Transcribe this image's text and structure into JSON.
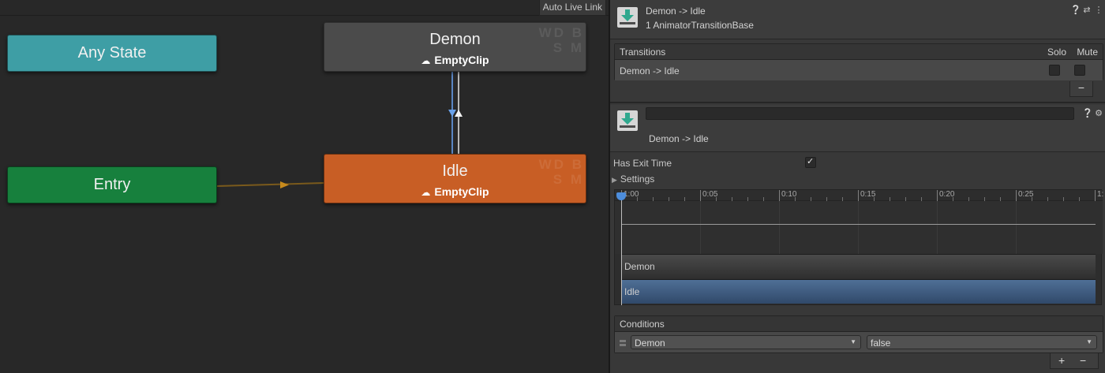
{
  "graph": {
    "auto_live_link": "Auto Live Link",
    "nodes": {
      "any_state": {
        "title": "Any State",
        "color": "#3e9ea5"
      },
      "entry": {
        "title": "Entry",
        "color": "#17803d"
      },
      "demon": {
        "title": "Demon",
        "clip": "EmptyClip",
        "badge_top": "WD B",
        "badge_bottom": "S M",
        "color": "#4b4b4b"
      },
      "idle": {
        "title": "Idle",
        "clip": "EmptyClip",
        "badge_top": "WD B",
        "badge_bottom": "S M",
        "color": "#c85e25"
      }
    }
  },
  "inspector": {
    "header": {
      "title": "Demon -> Idle",
      "subtitle": "1 AnimatorTransitionBase",
      "icons": [
        "help-icon",
        "settings-sliders-icon",
        "more-icon"
      ]
    },
    "transitions": {
      "header": "Transitions",
      "solo_label": "Solo",
      "mute_label": "Mute",
      "rows": [
        {
          "name": "Demon -> Idle",
          "solo": false,
          "mute": false
        }
      ],
      "remove_label": "−"
    },
    "transition_detail": {
      "name_value": "",
      "label": "Demon -> Idle",
      "icons": [
        "help-icon",
        "gear-icon"
      ]
    },
    "has_exit_time": {
      "label": "Has Exit Time",
      "checked": true
    },
    "settings": {
      "label": "Settings"
    },
    "timeline": {
      "ticks": [
        "1:00",
        "0:05",
        "0:10",
        "0:15",
        "0:20",
        "0:25",
        "1:"
      ],
      "bars": {
        "source": "Demon",
        "destination": "Idle"
      }
    },
    "conditions": {
      "header": "Conditions",
      "rows": [
        {
          "parameter": "Demon",
          "value": "false"
        }
      ],
      "add_label": "+",
      "remove_label": "−"
    }
  }
}
